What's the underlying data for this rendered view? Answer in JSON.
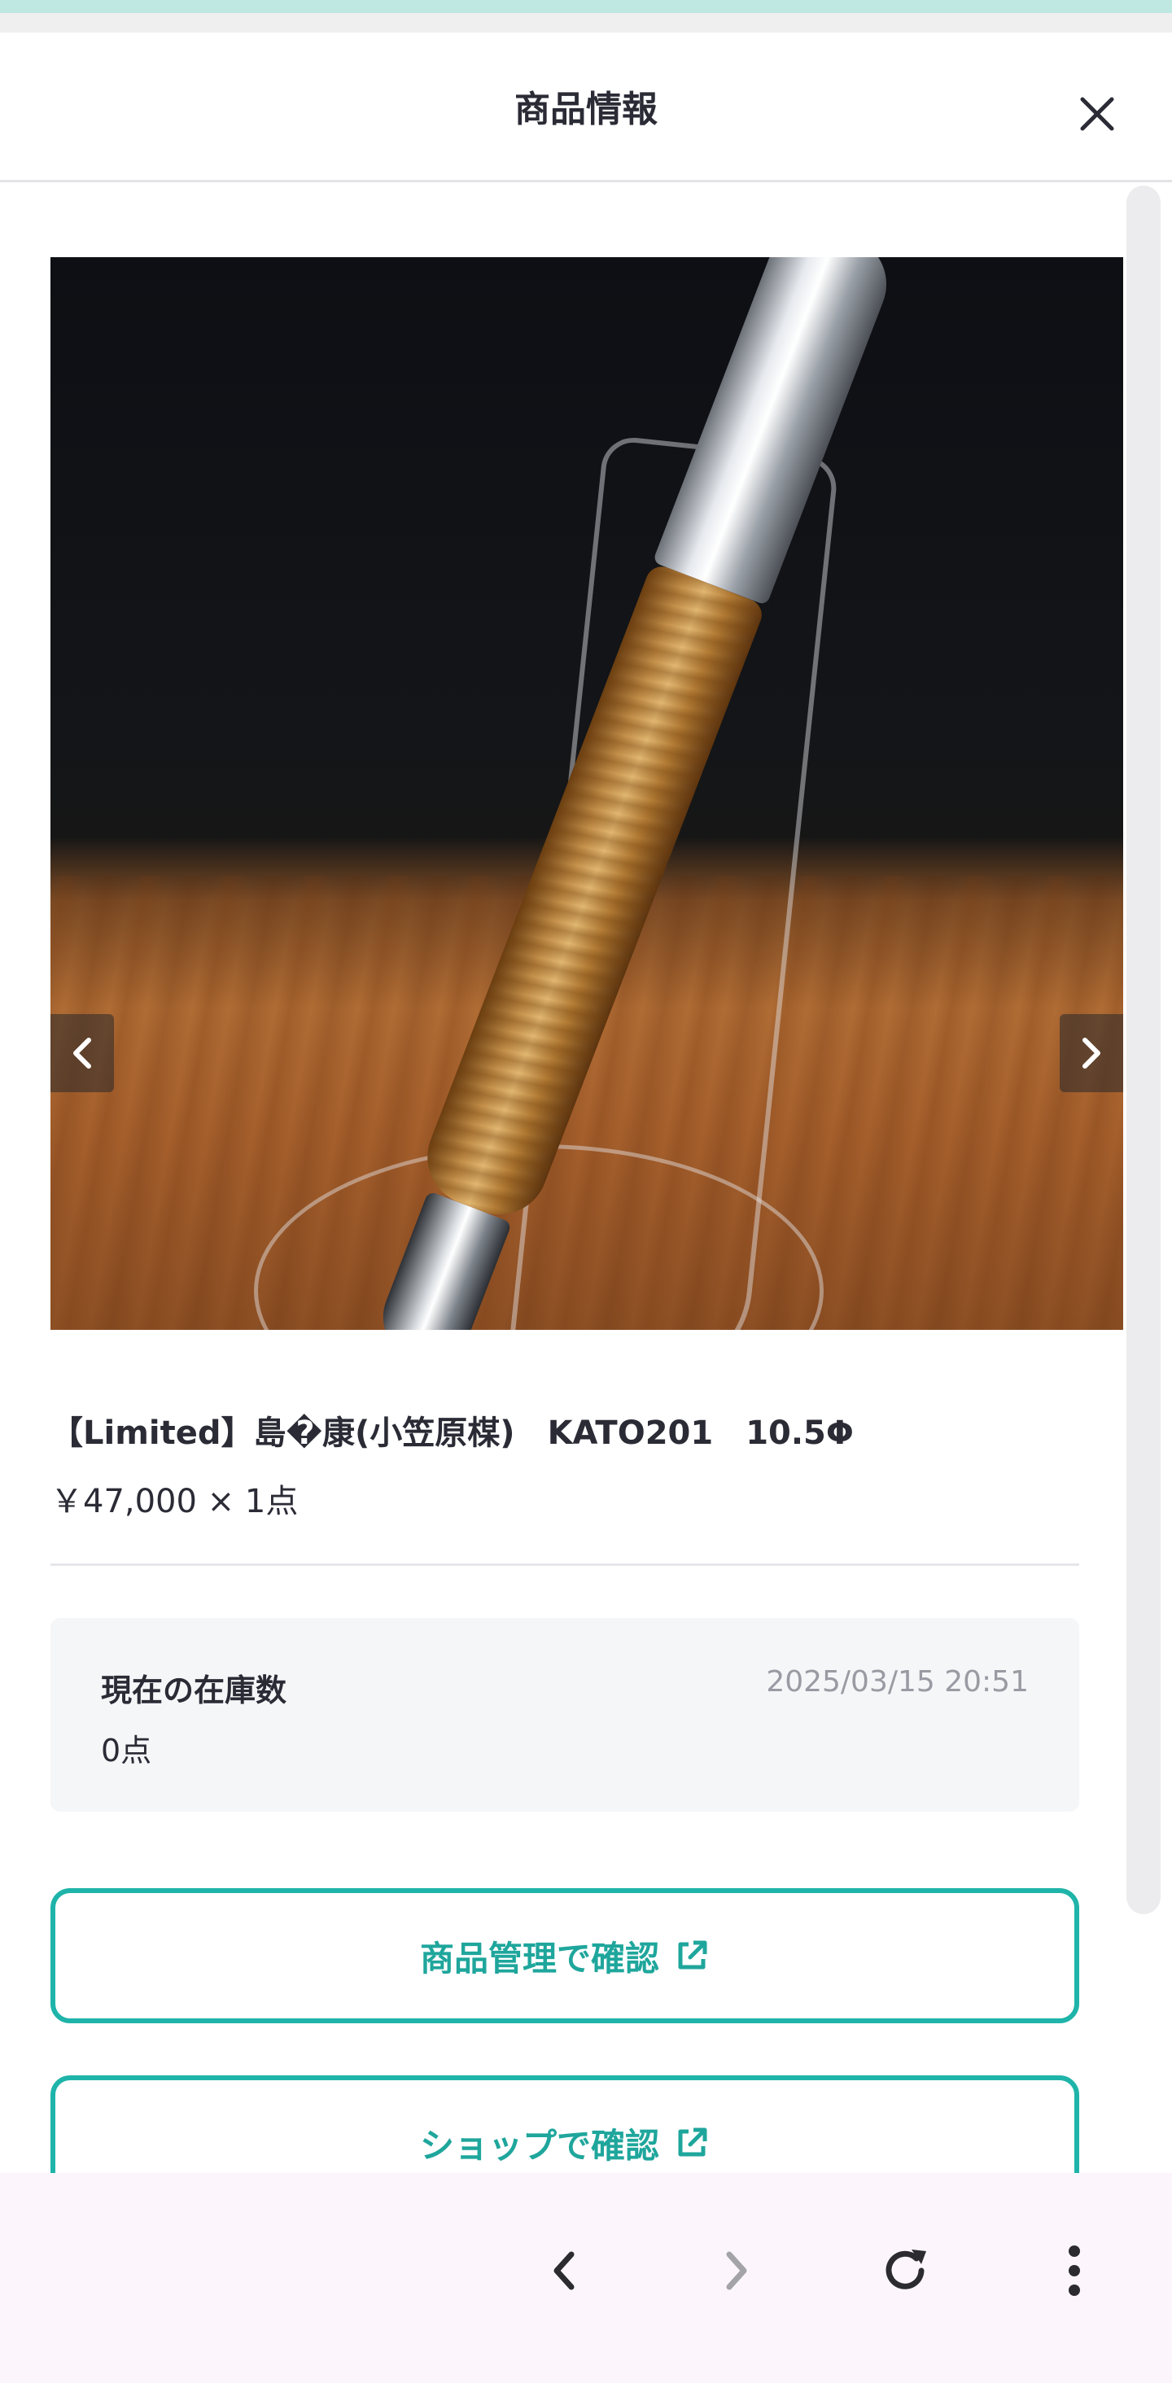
{
  "header": {
    "title": "商品情報",
    "close_icon": "close-icon"
  },
  "carousel": {
    "total_images": 9,
    "active_index": 0,
    "prev_icon": "chevron-left-icon",
    "next_icon": "chevron-right-icon",
    "accent_color": "#1fb4a9"
  },
  "product": {
    "title": "【Limited】島�康(小笠原楳)　KATO201　10.5Φ",
    "price": "￥47,000 × 1点"
  },
  "stock": {
    "label": "現在の在庫数",
    "value": "0点",
    "updated_at": "2025/03/15 20:51"
  },
  "actions": {
    "manage_label": "商品管理で確認",
    "shop_label": "ショップで確認",
    "external_icon": "external-link-icon"
  },
  "browser_nav": {
    "back_icon": "chevron-left-icon",
    "forward_icon": "chevron-right-icon",
    "reload_icon": "reload-icon",
    "menu_icon": "more-vertical-icon"
  },
  "colors": {
    "accent": "#1fb4a9",
    "text": "#2b2b36",
    "muted": "#9a9aa3"
  }
}
